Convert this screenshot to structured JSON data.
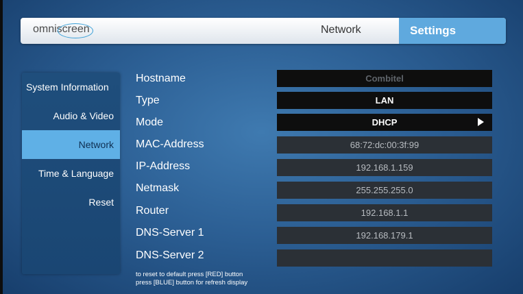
{
  "topbar": {
    "logo_text": "omniscreen",
    "section": "Network",
    "title": "Settings"
  },
  "sidebar": {
    "items": [
      {
        "label": "System Information"
      },
      {
        "label": "Audio & Video"
      },
      {
        "label": "Network"
      },
      {
        "label": "Time & Language"
      },
      {
        "label": "Reset"
      }
    ],
    "active_item": "Network"
  },
  "network": {
    "hostname": {
      "label": "Hostname",
      "value": "Combitel"
    },
    "type": {
      "label": "Type",
      "value": "LAN"
    },
    "mode": {
      "label": "Mode",
      "value": "DHCP"
    },
    "mac": {
      "label": "MAC-Address",
      "value": "68:72:dc:00:3f:99"
    },
    "ip": {
      "label": "IP-Address",
      "value": "192.168.1.159"
    },
    "netmask": {
      "label": "Netmask",
      "value": "255.255.255.0"
    },
    "router": {
      "label": "Router",
      "value": "192.168.1.1"
    },
    "dns1": {
      "label": "DNS-Server 1",
      "value": "192.168.179.1"
    },
    "dns2": {
      "label": "DNS-Server 2",
      "value": ""
    }
  },
  "hints": {
    "line1": "to reset to default press [RED] button",
    "line2": "press [BLUE] button for refresh display"
  },
  "colors": {
    "accent": "#5fb0e6",
    "background": "#2c5f94"
  }
}
